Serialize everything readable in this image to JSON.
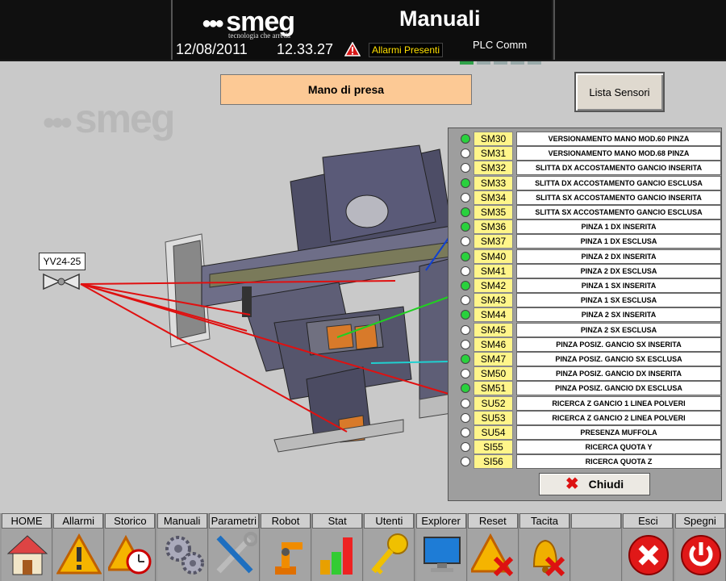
{
  "header": {
    "brand": "smeg",
    "tagline": "tecnologia che arreda",
    "title": "Manuali",
    "date": "12/08/2011",
    "time": "12.33.27",
    "alarm_text": "Allarmi Presenti",
    "plc_label": "PLC Comm",
    "plc_bars": [
      true,
      false,
      false,
      false,
      false
    ]
  },
  "main": {
    "section_title": "Mano di presa",
    "sensor_list_button": "Lista Sensori",
    "watermark": "smeg",
    "valve_label": "YV24-25"
  },
  "panel": {
    "close_label": "Chiudi",
    "sensors": [
      {
        "code": "SM30",
        "desc": "VERSIONAMENTO MANO MOD.60 PINZA",
        "on": true
      },
      {
        "code": "SM31",
        "desc": "VERSIONAMENTO MANO MOD.68 PINZA",
        "on": false
      },
      {
        "code": "SM32",
        "desc": "SLITTA DX ACCOSTAMENTO GANCIO INSERITA",
        "on": false
      },
      {
        "code": "SM33",
        "desc": "SLITTA DX ACCOSTAMENTO GANCIO ESCLUSA",
        "on": true
      },
      {
        "code": "SM34",
        "desc": "SLITTA SX ACCOSTAMENTO GANCIO INSERITA",
        "on": false
      },
      {
        "code": "SM35",
        "desc": "SLITTA SX ACCOSTAMENTO GANCIO ESCLUSA",
        "on": true
      },
      {
        "code": "SM36",
        "desc": "PINZA 1 DX INSERITA",
        "on": true
      },
      {
        "code": "SM37",
        "desc": "PINZA 1 DX ESCLUSA",
        "on": false
      },
      {
        "code": "SM40",
        "desc": "PINZA 2 DX INSERITA",
        "on": true
      },
      {
        "code": "SM41",
        "desc": "PINZA 2 DX ESCLUSA",
        "on": false
      },
      {
        "code": "SM42",
        "desc": "PINZA 1 SX INSERITA",
        "on": true
      },
      {
        "code": "SM43",
        "desc": "PINZA 1 SX ESCLUSA",
        "on": false
      },
      {
        "code": "SM44",
        "desc": "PINZA 2 SX INSERITA",
        "on": true
      },
      {
        "code": "SM45",
        "desc": "PINZA 2 SX ESCLUSA",
        "on": false
      },
      {
        "code": "SM46",
        "desc": "PINZA POSIZ. GANCIO SX INSERITA",
        "on": false
      },
      {
        "code": "SM47",
        "desc": "PINZA POSIZ. GANCIO SX ESCLUSA",
        "on": true
      },
      {
        "code": "SM50",
        "desc": "PINZA POSIZ. GANCIO DX INSERITA",
        "on": false
      },
      {
        "code": "SM51",
        "desc": "PINZA POSIZ. GANCIO DX ESCLUSA",
        "on": true
      },
      {
        "code": "SU52",
        "desc": "RICERCA Z GANCIO 1 LINEA POLVERI",
        "on": false
      },
      {
        "code": "SU53",
        "desc": "RICERCA Z GANCIO 2 LINEA POLVERI",
        "on": false
      },
      {
        "code": "SU54",
        "desc": "PRESENZA MUFFOLA",
        "on": false
      },
      {
        "code": "SI55",
        "desc": "RICERCA QUOTA Y",
        "on": false
      },
      {
        "code": "SI56",
        "desc": "RICERCA QUOTA Z",
        "on": false
      }
    ]
  },
  "nav": {
    "items": [
      {
        "label": "HOME",
        "icon": "home-icon"
      },
      {
        "label": "Allarmi",
        "icon": "warning-icon"
      },
      {
        "label": "Storico",
        "icon": "clock-warning-icon"
      },
      {
        "label": "Manuali",
        "icon": "gears-icon"
      },
      {
        "label": "Parametri",
        "icon": "tools-icon"
      },
      {
        "label": "Robot",
        "icon": "robot-icon"
      },
      {
        "label": "Stat",
        "icon": "bar-chart-icon"
      },
      {
        "label": "Utenti",
        "icon": "key-icon"
      },
      {
        "label": "Explorer",
        "icon": "monitor-icon"
      },
      {
        "label": "Reset",
        "icon": "reset-warning-icon"
      },
      {
        "label": "Tacita",
        "icon": "bell-off-icon"
      },
      {
        "label": "",
        "icon": ""
      },
      {
        "label": "Esci",
        "icon": "exit-icon"
      },
      {
        "label": "Spegni",
        "icon": "power-icon"
      }
    ]
  },
  "colors": {
    "led_on": "#29d13d",
    "code_bg": "#fff58a",
    "title_bg": "#fcc995"
  }
}
